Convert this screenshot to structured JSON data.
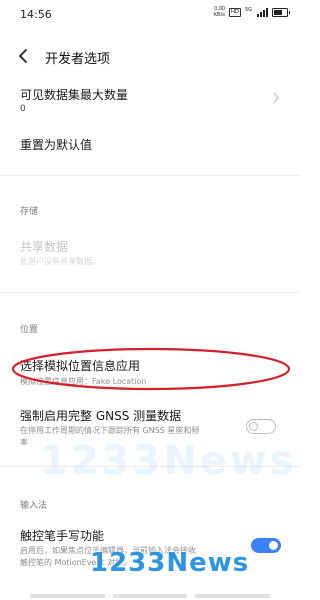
{
  "status_bar": {
    "time": "14:56",
    "net_speed_value": "0.00",
    "net_speed_unit": "KB/s",
    "hd_label": "HD",
    "signal_label": "5G"
  },
  "header": {
    "title": "开发者选项"
  },
  "items": {
    "max_visible_datasets": {
      "title": "可见数据集最大数量",
      "value": "0"
    },
    "reset_default": {
      "title": "重置为默认值"
    },
    "shared_data": {
      "title": "共享数据",
      "subtitle": "此用户没有共享数据。"
    },
    "mock_location_app": {
      "title": "选择模拟位置信息应用",
      "subtitle": "模拟位置信息应用：Fake Location"
    },
    "force_gnss": {
      "title": "强制启用完整 GNSS 测量数据",
      "subtitle_line1": "在停用工作周期的情况下跟踪所有 GNSS 星座和频",
      "subtitle_line2": "率",
      "enabled": false
    },
    "stylus_handwriting": {
      "title": "触控笔手写功能",
      "subtitle_line1": "启用后，如果焦点位于编辑器，当前输入法会接收",
      "subtitle_line2": "触控笔的 MotionEvent 对象。",
      "enabled": true
    }
  },
  "sections": {
    "storage": "存储",
    "location": "位置",
    "input_method": "输入法"
  },
  "watermark": {
    "text": "1233News"
  },
  "colors": {
    "accent": "#3b82f6",
    "annotation": "#d4202a",
    "watermark": "#1d8fe0",
    "disabled_text": "#c4c4c4"
  }
}
